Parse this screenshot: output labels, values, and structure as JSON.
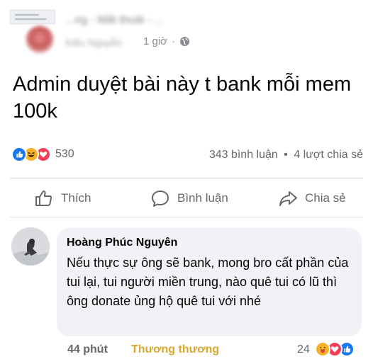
{
  "post": {
    "group_name": "...ng - Mất thoải - ...",
    "author_name": "Kiếu Nguyễn",
    "time": "1 giờ",
    "separator": "·",
    "text": "Admin duyệt bài này t bank mỗi mem 100k"
  },
  "reactions": {
    "count": "530",
    "types": [
      "like-icon",
      "haha-icon",
      "love-icon"
    ],
    "colors": {
      "like": "#1877f2",
      "haha": "#f7b125",
      "love": "#f33e58"
    }
  },
  "stats": {
    "comments": "343 bình luận",
    "dot": "•",
    "shares": "4 lượt chia sẻ"
  },
  "actions": {
    "like_label": "Thích",
    "comment_label": "Bình luận",
    "share_label": "Chia sẻ"
  },
  "comment": {
    "author": "Hoàng Phúc Nguyên",
    "text": "Nếu thực sự ông sẽ bank, mong bro cất phần của tui lại, tui người miền trung, nào quê tui có lũ thì ông donate ủng hộ quê tui với nhé",
    "time": "44 phút",
    "reaction_label": "Thương thương",
    "reaction_count": "24",
    "reaction_types": [
      "care-icon",
      "love-icon",
      "like-icon"
    ]
  }
}
